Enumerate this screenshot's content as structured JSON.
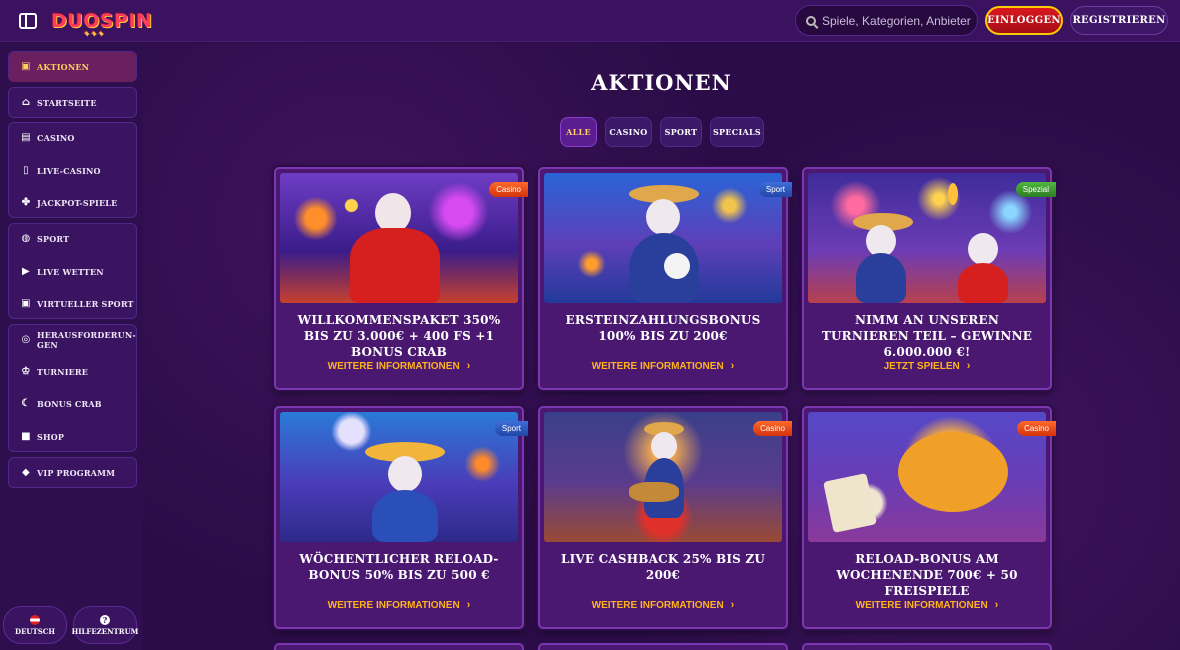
{
  "header": {
    "logo_text": "DUOSPIN",
    "search_placeholder": "Spiele, Kategorien, Anbieter",
    "login_label": "EINLOGGEN",
    "register_label": "REGISTRIEREN"
  },
  "sidebar": {
    "items": [
      {
        "label": "AKTIONEN",
        "icon": "gift-icon"
      },
      {
        "label": "STARTSEITE",
        "icon": "home-icon"
      },
      {
        "label": "CASINO",
        "icon": "slot-icon"
      },
      {
        "label": "LIVE-CASINO",
        "icon": "phone-icon"
      },
      {
        "label": "JACKPOT-SPIELE",
        "icon": "clover-icon"
      },
      {
        "label": "SPORT",
        "icon": "ball-icon"
      },
      {
        "label": "LIVE WETTEN",
        "icon": "play-icon"
      },
      {
        "label": "VIRTUELLER SPORT",
        "icon": "monitor-icon"
      },
      {
        "label": "HERAUSFORDERUN-GEN",
        "icon": "target-icon"
      },
      {
        "label": "TURNIERE",
        "icon": "trophy-icon"
      },
      {
        "label": "BONUS CRAB",
        "icon": "crab-icon"
      },
      {
        "label": "SHOP",
        "icon": "bag-icon"
      },
      {
        "label": "VIP PROGRAMM",
        "icon": "diamond-icon"
      }
    ],
    "language_label": "DEUTSCH",
    "help_label": "HILFEZENTRUM"
  },
  "main": {
    "title": "AKTIONEN",
    "filters": [
      "ALLE",
      "CASINO",
      "SPORT",
      "SPECIALS"
    ],
    "active_filter": "ALLE",
    "cards": [
      {
        "badge": "Casino",
        "title": "WILLKOMMENSPAKET 350% BIS ZU 3.000€ + 400 FS +1 BONUS CRAB",
        "link": "WEITERE INFORMATIONEN"
      },
      {
        "badge": "Sport",
        "title": "ERSTEINZAHLUNGSBONUS 100% BIS ZU 200€",
        "link": "WEITERE INFORMATIONEN"
      },
      {
        "badge": "Spezial",
        "title": "NIMM AN UNSEREN TURNIEREN TEIL – GEWINNE 6.000.000 €!",
        "link": "JETZT SPIELEN"
      },
      {
        "badge": "Sport",
        "title": "WÖCHENTLICHER RELOAD-BONUS 50% BIS ZU 500 €",
        "link": "WEITERE INFORMATIONEN"
      },
      {
        "badge": "Casino",
        "title": "LIVE CASHBACK 25% BIS ZU 200€",
        "link": "WEITERE INFORMATIONEN"
      },
      {
        "badge": "Casino",
        "title": "RELOAD-BONUS AM WOCHENENDE 700€ + 50 FREISPIELE",
        "link": "WEITERE INFORMATIONEN"
      }
    ]
  },
  "colors": {
    "accent_gold": "#ffb21e",
    "login_red": "#d8181e",
    "badge_casino": "#ff6a2a",
    "badge_sport": "#3f6ed9",
    "badge_spezial": "#4fb83f"
  }
}
